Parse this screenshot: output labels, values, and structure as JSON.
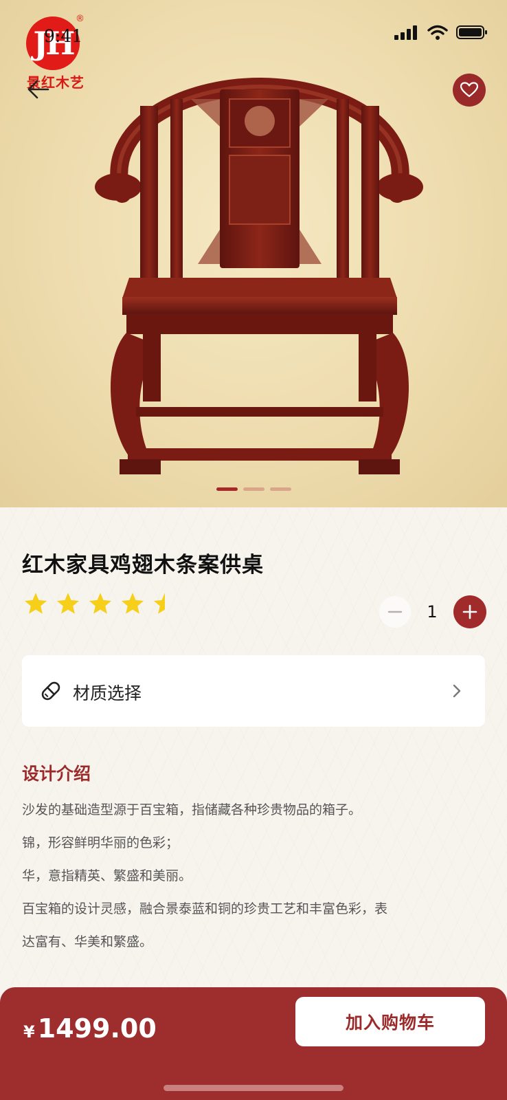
{
  "status_bar": {
    "time": "9:41"
  },
  "brand": {
    "logo_mark": "JH",
    "registered": "®",
    "name": "景红木艺"
  },
  "hero": {
    "image_subject": "rosewood armchair",
    "carousel": {
      "total": 3,
      "active_index": 0
    }
  },
  "product": {
    "title": "红木家具鸡翅木条案供桌",
    "rating": {
      "value": 4.5,
      "max": 5
    },
    "quantity": "1"
  },
  "options": {
    "material_label": "材质选择"
  },
  "design": {
    "section_title": "设计介绍",
    "paragraphs": [
      "沙发的基础造型源于百宝箱，指储藏各种珍贵物品的箱子。",
      "锦，形容鲜明华丽的色彩；",
      "华，意指精英、繁盛和美丽。",
      "百宝箱的设计灵感，融合景泰蓝和铜的珍贵工艺和丰富色彩，表",
      "达富有、华美和繁盛。"
    ]
  },
  "footer": {
    "currency": "¥",
    "price": "1499.00",
    "add_to_cart_label": "加入购物车"
  },
  "colors": {
    "accent": "#9e2d2d",
    "star": "#f6cf1a",
    "wood": "#7a1c14"
  },
  "icons": [
    "arrow-left-icon",
    "heart-icon",
    "star-icon",
    "minus-icon",
    "plus-icon",
    "pill-icon",
    "chevron-right-icon",
    "signal-icon",
    "wifi-icon",
    "battery-icon"
  ]
}
